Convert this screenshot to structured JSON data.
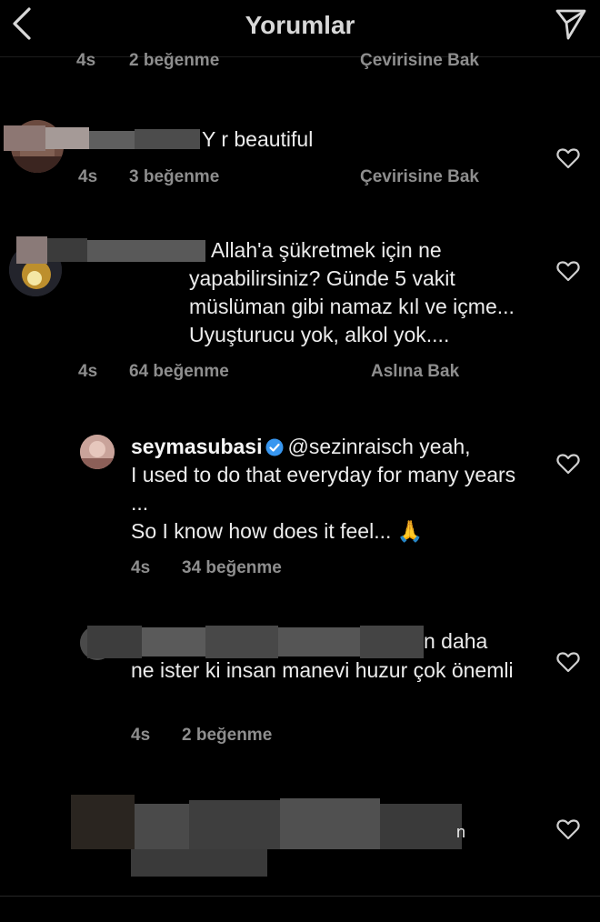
{
  "header": {
    "title": "Yorumlar",
    "icon_back": "chevron-left-icon",
    "icon_send": "send-icon"
  },
  "comments": [
    {
      "text": "",
      "time": "4s",
      "likes": "2 beğenme",
      "action": "Çevirisine Bak"
    },
    {
      "text": "Y r beautiful",
      "time": "4s",
      "likes": "3 beğenme",
      "action": "Çevirisine Bak"
    },
    {
      "text": "Allah'a şükretmek için ne yapabilirsiniz? Günde 5 vakit müslüman gibi namaz kıl ve içme... Uyuşturucu yok, alkol yok....",
      "time": "4s",
      "likes": "64 beğenme",
      "action": "Aslına Bak"
    },
    {
      "username": "seymasubasi",
      "mention": "@sezinraisch",
      "text_line1": " yeah,",
      "text_rest": "I used to do that everyday for many years ...",
      "text_last": "So I know how does it feel... 🙏",
      "time": "4s",
      "likes": "34 beğenme"
    },
    {
      "text_tail": "n daha",
      "text_rest": "ne ister ki insan manevi huzur çok önemli",
      "time": "4s",
      "likes": "2 beğenme"
    },
    {
      "text_tail": "n"
    }
  ],
  "colors": {
    "background": "#000000",
    "text": "#ececec",
    "meta": "#8e8e8e",
    "verified": "#3897f0"
  }
}
